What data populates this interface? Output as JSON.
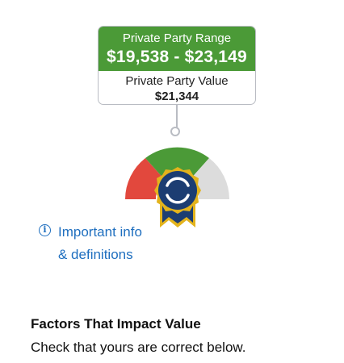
{
  "range_card": {
    "range_label": "Private Party Range",
    "range_value": "$19,538 - $23,149",
    "value_label": "Private Party Value",
    "value_amount": "$21,344"
  },
  "gauge": {
    "colors": {
      "low": "#e2483d",
      "fair": "#4b9a37",
      "high": "#dcdcdc",
      "badge": "#1c3d72",
      "badge_trim": "#e3b31c"
    },
    "icons": [
      "ribbon-badge-icon"
    ]
  },
  "info": {
    "icon": "info-icon",
    "line1": "Important info",
    "line2": "& definitions"
  },
  "factors": {
    "title": "Factors That Impact Value",
    "subtitle": "Check that yours are correct below."
  }
}
